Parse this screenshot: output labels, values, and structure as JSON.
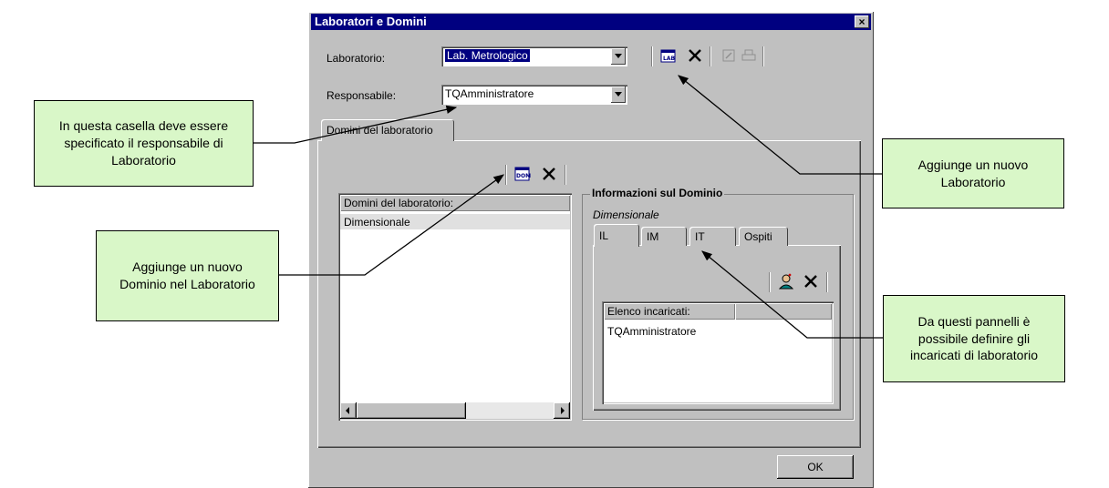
{
  "window": {
    "title": "Laboratori e Domini",
    "close_glyph": "×"
  },
  "laboratorio": {
    "label": "Laboratorio:",
    "value": "Lab. Metrologico"
  },
  "responsabile": {
    "label": "Responsabile:",
    "value": "TQAmministratore"
  },
  "main_tab": {
    "label": "Domini del laboratorio"
  },
  "domini_list": {
    "header": "Domini del laboratorio:",
    "items": [
      "Dimensionale"
    ]
  },
  "info_group": {
    "title": "Informazioni sul Dominio",
    "subtitle": "Dimensionale"
  },
  "inner_tabs": [
    "IL",
    "IM",
    "IT",
    "Ospiti"
  ],
  "incaricati_list": {
    "header": "Elenco incaricati:",
    "items": [
      "TQAmministratore"
    ]
  },
  "ok_button": {
    "label": "OK"
  },
  "icons": {
    "add_lab": "lab-add-icon",
    "delete": "delete-icon",
    "add_domain": "domain-add-icon",
    "add_person": "person-add-icon"
  },
  "callouts": {
    "responsabile_note": "In questa casella deve essere  specificato il responsabile di Laboratorio",
    "add_lab_note": "Aggiunge un nuovo Laboratorio",
    "add_domain_note": "Aggiunge un nuovo Dominio nel Laboratorio",
    "incaricati_note": "Da questi pannelli è possibile definire gli incaricati di laboratorio"
  },
  "colors": {
    "callout_bg": "#d9f7c8",
    "titlebar": "#000080",
    "dialog": "#c0c0c0"
  }
}
